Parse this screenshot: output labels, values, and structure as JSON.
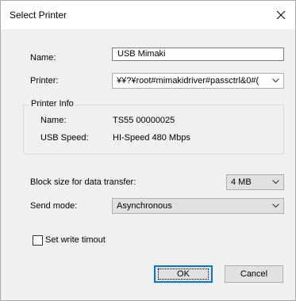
{
  "window": {
    "title": "Select Printer",
    "close_icon": "close-icon"
  },
  "form": {
    "name_label": "Name:",
    "name_value": "USB Mimaki",
    "printer_label": "Printer:",
    "printer_value": "\\\\?\\root#mimakidriver#passctrl&0#{",
    "printer_value_display": "¥¥?¥root#mimakidriver#passctrl&0#("
  },
  "printer_info": {
    "group_title": "Printer Info",
    "name_label": "Name:",
    "name_value": "TS55 00000025",
    "usb_speed_label": "USB Speed:",
    "usb_speed_value": "HI-Speed 480 Mbps"
  },
  "transfer": {
    "block_size_label": "Block size for data transfer:",
    "block_size_value": "4 MB",
    "send_mode_label": "Send mode:",
    "send_mode_value": "Asynchronous",
    "write_timeout_label": "Set write timout",
    "write_timeout_checked": false
  },
  "buttons": {
    "ok_label": "OK",
    "cancel_label": "Cancel"
  },
  "colors": {
    "dialog_bg": "#f0f0f0",
    "title_bg": "#ffffff",
    "default_button_border": "#0078d7"
  }
}
